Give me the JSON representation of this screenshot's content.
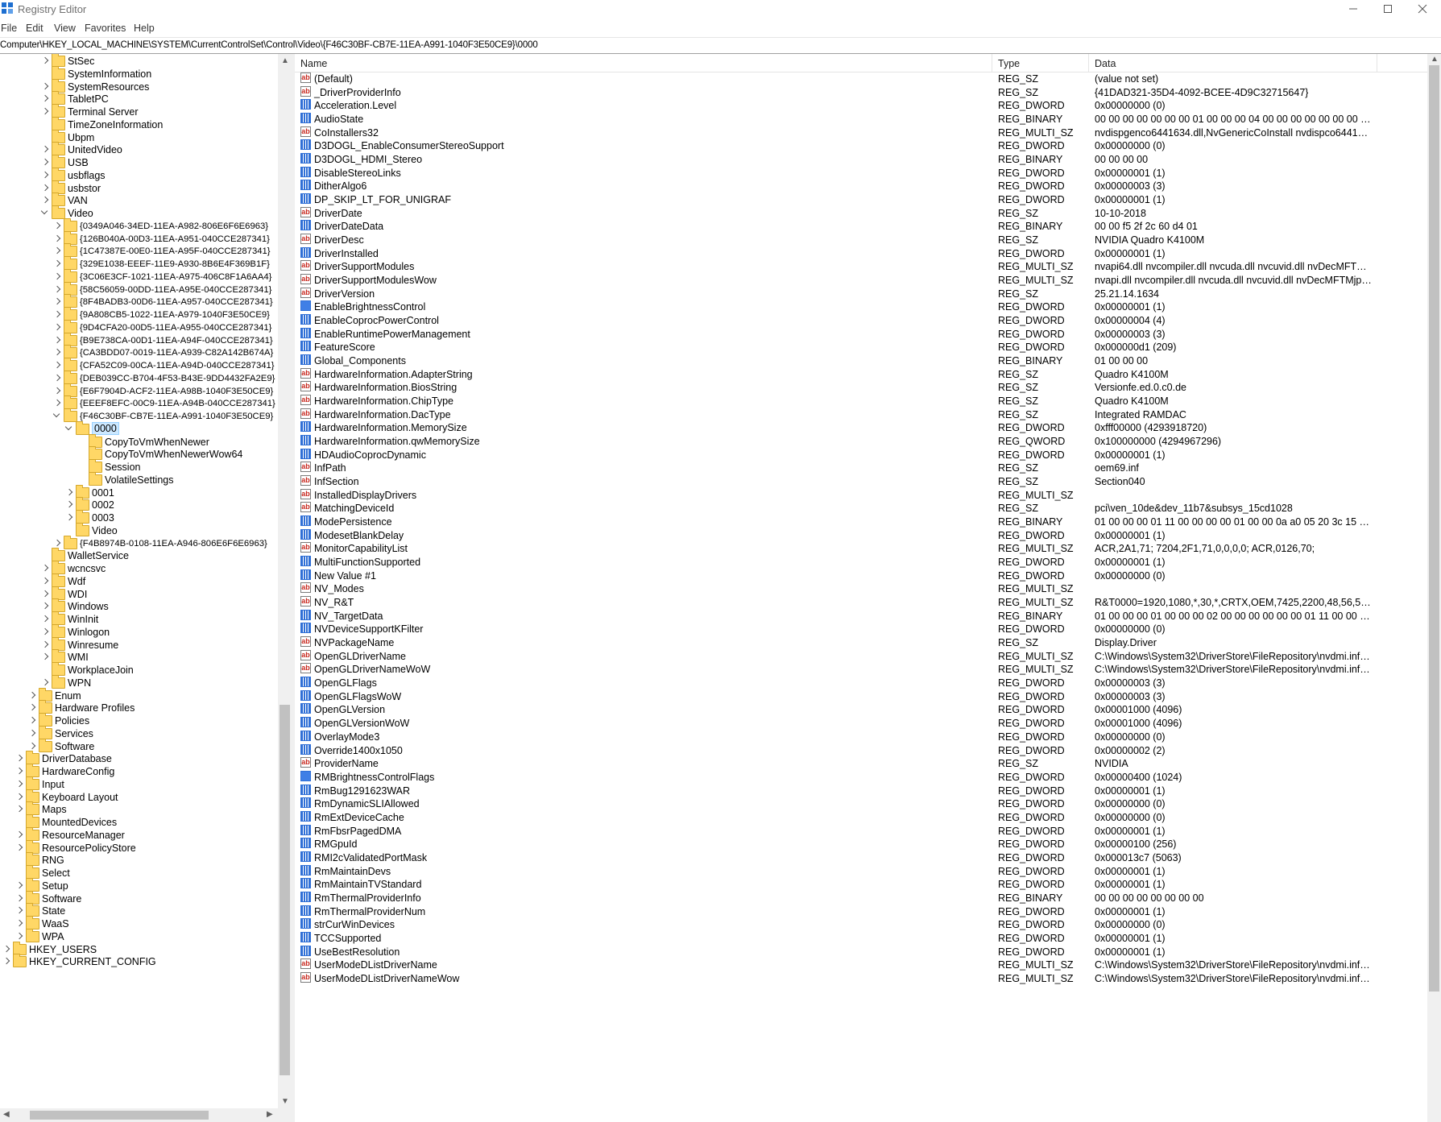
{
  "window": {
    "title": "Registry Editor"
  },
  "menu": [
    "File",
    "Edit",
    "View",
    "Favorites",
    "Help"
  ],
  "address": "Computer\\HKEY_LOCAL_MACHINE\\SYSTEM\\CurrentControlSet\\Control\\Video\\{F46C30BF-CB7E-11EA-A991-1040F3E50CE9}\\0000",
  "tree": [
    {
      "label": "StSec",
      "level": 3,
      "expander": "closed"
    },
    {
      "label": "SystemInformation",
      "level": 3,
      "expander": "none"
    },
    {
      "label": "SystemResources",
      "level": 3,
      "expander": "closed"
    },
    {
      "label": "TabletPC",
      "level": 3,
      "expander": "closed"
    },
    {
      "label": "Terminal Server",
      "level": 3,
      "expander": "closed"
    },
    {
      "label": "TimeZoneInformation",
      "level": 3,
      "expander": "none"
    },
    {
      "label": "Ubpm",
      "level": 3,
      "expander": "none"
    },
    {
      "label": "UnitedVideo",
      "level": 3,
      "expander": "closed"
    },
    {
      "label": "USB",
      "level": 3,
      "expander": "closed"
    },
    {
      "label": "usbflags",
      "level": 3,
      "expander": "closed"
    },
    {
      "label": "usbstor",
      "level": 3,
      "expander": "closed"
    },
    {
      "label": "VAN",
      "level": 3,
      "expander": "closed"
    },
    {
      "label": "Video",
      "level": 3,
      "expander": "open"
    },
    {
      "label": "{0349A046-34ED-11EA-A982-806E6F6E6963}",
      "level": 4,
      "expander": "closed",
      "small": true
    },
    {
      "label": "{126B040A-00D3-11EA-A951-040CCE287341}",
      "level": 4,
      "expander": "closed",
      "small": true
    },
    {
      "label": "{1C47387E-00E0-11EA-A95F-040CCE287341}",
      "level": 4,
      "expander": "closed",
      "small": true
    },
    {
      "label": "{329E1038-EEEF-11E9-A930-8B6E4F369B1F}",
      "level": 4,
      "expander": "closed",
      "small": true
    },
    {
      "label": "{3C06E3CF-1021-11EA-A975-406C8F1A6AA4}",
      "level": 4,
      "expander": "closed",
      "small": true
    },
    {
      "label": "{58C56059-00DD-11EA-A95E-040CCE287341}",
      "level": 4,
      "expander": "closed",
      "small": true
    },
    {
      "label": "{8F4BADB3-00D6-11EA-A957-040CCE287341}",
      "level": 4,
      "expander": "closed",
      "small": true
    },
    {
      "label": "{9A808CB5-1022-11EA-A979-1040F3E50CE9}",
      "level": 4,
      "expander": "closed",
      "small": true
    },
    {
      "label": "{9D4CFA20-00D5-11EA-A955-040CCE287341}",
      "level": 4,
      "expander": "closed",
      "small": true
    },
    {
      "label": "{B9E738CA-00D1-11EA-A94F-040CCE287341}",
      "level": 4,
      "expander": "closed",
      "small": true
    },
    {
      "label": "{CA3BDD07-0019-11EA-A939-C82A142B674A}",
      "level": 4,
      "expander": "closed",
      "small": true
    },
    {
      "label": "{CFA52C09-00CA-11EA-A94D-040CCE287341}",
      "level": 4,
      "expander": "closed",
      "small": true
    },
    {
      "label": "{DEB039CC-B704-4F53-B43E-9DD4432FA2E9}",
      "level": 4,
      "expander": "closed",
      "small": true
    },
    {
      "label": "{E6F7904D-ACF2-11EA-A98B-1040F3E50CE9}",
      "level": 4,
      "expander": "closed",
      "small": true
    },
    {
      "label": "{EEEF8EFC-00C9-11EA-A94B-040CCE287341}",
      "level": 4,
      "expander": "closed",
      "small": true
    },
    {
      "label": "{F46C30BF-CB7E-11EA-A991-1040F3E50CE9}",
      "level": 4,
      "expander": "open",
      "small": true
    },
    {
      "label": "0000",
      "level": 5,
      "expander": "open",
      "selected": true
    },
    {
      "label": "CopyToVmWhenNewer",
      "level": 6,
      "expander": "none"
    },
    {
      "label": "CopyToVmWhenNewerWow64",
      "level": 6,
      "expander": "none"
    },
    {
      "label": "Session",
      "level": 6,
      "expander": "none"
    },
    {
      "label": "VolatileSettings",
      "level": 6,
      "expander": "none"
    },
    {
      "label": "0001",
      "level": 5,
      "expander": "closed"
    },
    {
      "label": "0002",
      "level": 5,
      "expander": "closed"
    },
    {
      "label": "0003",
      "level": 5,
      "expander": "closed"
    },
    {
      "label": "Video",
      "level": 5,
      "expander": "none"
    },
    {
      "label": "{F4B8974B-0108-11EA-A946-806E6F6E6963}",
      "level": 4,
      "expander": "closed",
      "small": true
    },
    {
      "label": "WalletService",
      "level": 3,
      "expander": "none"
    },
    {
      "label": "wcncsvc",
      "level": 3,
      "expander": "closed"
    },
    {
      "label": "Wdf",
      "level": 3,
      "expander": "closed"
    },
    {
      "label": "WDI",
      "level": 3,
      "expander": "closed"
    },
    {
      "label": "Windows",
      "level": 3,
      "expander": "closed"
    },
    {
      "label": "WinInit",
      "level": 3,
      "expander": "closed"
    },
    {
      "label": "Winlogon",
      "level": 3,
      "expander": "closed"
    },
    {
      "label": "Winresume",
      "level": 3,
      "expander": "closed"
    },
    {
      "label": "WMI",
      "level": 3,
      "expander": "closed"
    },
    {
      "label": "WorkplaceJoin",
      "level": 3,
      "expander": "none"
    },
    {
      "label": "WPN",
      "level": 3,
      "expander": "closed"
    },
    {
      "label": "Enum",
      "level": 2,
      "expander": "closed"
    },
    {
      "label": "Hardware Profiles",
      "level": 2,
      "expander": "closed"
    },
    {
      "label": "Policies",
      "level": 2,
      "expander": "closed"
    },
    {
      "label": "Services",
      "level": 2,
      "expander": "closed"
    },
    {
      "label": "Software",
      "level": 2,
      "expander": "closed"
    },
    {
      "label": "DriverDatabase",
      "level": 1,
      "expander": "closed"
    },
    {
      "label": "HardwareConfig",
      "level": 1,
      "expander": "closed"
    },
    {
      "label": "Input",
      "level": 1,
      "expander": "closed"
    },
    {
      "label": "Keyboard Layout",
      "level": 1,
      "expander": "closed"
    },
    {
      "label": "Maps",
      "level": 1,
      "expander": "closed"
    },
    {
      "label": "MountedDevices",
      "level": 1,
      "expander": "none"
    },
    {
      "label": "ResourceManager",
      "level": 1,
      "expander": "closed"
    },
    {
      "label": "ResourcePolicyStore",
      "level": 1,
      "expander": "closed"
    },
    {
      "label": "RNG",
      "level": 1,
      "expander": "none"
    },
    {
      "label": "Select",
      "level": 1,
      "expander": "none"
    },
    {
      "label": "Setup",
      "level": 1,
      "expander": "closed"
    },
    {
      "label": "Software",
      "level": 1,
      "expander": "closed"
    },
    {
      "label": "State",
      "level": 1,
      "expander": "closed"
    },
    {
      "label": "WaaS",
      "level": 1,
      "expander": "closed"
    },
    {
      "label": "WPA",
      "level": 1,
      "expander": "closed"
    },
    {
      "label": "HKEY_USERS",
      "level": 0,
      "expander": "closed"
    },
    {
      "label": "HKEY_CURRENT_CONFIG",
      "level": 0,
      "expander": "closed"
    }
  ],
  "columns": {
    "name": "Name",
    "type": "Type",
    "data": "Data"
  },
  "values": [
    {
      "name": "(Default)",
      "type": "REG_SZ",
      "data": "(value not set)",
      "icon": "sz"
    },
    {
      "name": "_DriverProviderInfo",
      "type": "REG_SZ",
      "data": "{41DAD321-35D4-4092-BCEE-4D9C32715647}",
      "icon": "sz"
    },
    {
      "name": "Acceleration.Level",
      "type": "REG_DWORD",
      "data": "0x00000000 (0)",
      "icon": "bin"
    },
    {
      "name": "AudioState",
      "type": "REG_BINARY",
      "data": "00 00 00 00 00 00 00 01 00 00 00 04 00 00 00 00 00 00 00 00 00 0...",
      "icon": "bin"
    },
    {
      "name": "CoInstallers32",
      "type": "REG_MULTI_SZ",
      "data": "nvdispgenco6441634.dll,NvGenericCoInstall nvdispco6441634.dll...",
      "icon": "sz"
    },
    {
      "name": "D3DOGL_EnableConsumerStereoSupport",
      "type": "REG_DWORD",
      "data": "0x00000000 (0)",
      "icon": "bin"
    },
    {
      "name": "D3DOGL_HDMI_Stereo",
      "type": "REG_BINARY",
      "data": "00 00 00 00",
      "icon": "bin"
    },
    {
      "name": "DisableStereoLinks",
      "type": "REG_DWORD",
      "data": "0x00000001 (1)",
      "icon": "bin"
    },
    {
      "name": "DitherAlgo6",
      "type": "REG_DWORD",
      "data": "0x00000003 (3)",
      "icon": "bin"
    },
    {
      "name": "DP_SKIP_LT_FOR_UNIGRAF",
      "type": "REG_DWORD",
      "data": "0x00000001 (1)",
      "icon": "bin"
    },
    {
      "name": "DriverDate",
      "type": "REG_SZ",
      "data": "10-10-2018",
      "icon": "sz"
    },
    {
      "name": "DriverDateData",
      "type": "REG_BINARY",
      "data": "00 00 f5 2f 2c 60 d4 01",
      "icon": "bin"
    },
    {
      "name": "DriverDesc",
      "type": "REG_SZ",
      "data": "NVIDIA Quadro K4100M",
      "icon": "sz"
    },
    {
      "name": "DriverInstalled",
      "type": "REG_DWORD",
      "data": "0x00000001 (1)",
      "icon": "bin"
    },
    {
      "name": "DriverSupportModules",
      "type": "REG_MULTI_SZ",
      "data": "nvapi64.dll nvcompiler.dll nvcuda.dll nvcuvid.dll nvDecMFTMjp...",
      "icon": "sz"
    },
    {
      "name": "DriverSupportModulesWow",
      "type": "REG_MULTI_SZ",
      "data": "nvapi.dll nvcompiler.dll nvcuda.dll nvcuvid.dll nvDecMFTMjpeg...",
      "icon": "sz"
    },
    {
      "name": "DriverVersion",
      "type": "REG_SZ",
      "data": "25.21.14.1634",
      "icon": "sz"
    },
    {
      "name": "EnableBrightnessControl",
      "type": "REG_DWORD",
      "data": "0x00000001 (1)",
      "icon": "binsel"
    },
    {
      "name": "EnableCoprocPowerControl",
      "type": "REG_DWORD",
      "data": "0x00000004 (4)",
      "icon": "bin"
    },
    {
      "name": "EnableRuntimePowerManagement",
      "type": "REG_DWORD",
      "data": "0x00000003 (3)",
      "icon": "bin"
    },
    {
      "name": "FeatureScore",
      "type": "REG_DWORD",
      "data": "0x000000d1 (209)",
      "icon": "bin"
    },
    {
      "name": "Global_Components",
      "type": "REG_BINARY",
      "data": "01 00 00 00",
      "icon": "bin"
    },
    {
      "name": "HardwareInformation.AdapterString",
      "type": "REG_SZ",
      "data": "Quadro K4100M",
      "icon": "sz"
    },
    {
      "name": "HardwareInformation.BiosString",
      "type": "REG_SZ",
      "data": "Versionfe.ed.0.c0.de",
      "icon": "sz"
    },
    {
      "name": "HardwareInformation.ChipType",
      "type": "REG_SZ",
      "data": "Quadro K4100M",
      "icon": "sz"
    },
    {
      "name": "HardwareInformation.DacType",
      "type": "REG_SZ",
      "data": "Integrated RAMDAC",
      "icon": "sz"
    },
    {
      "name": "HardwareInformation.MemorySize",
      "type": "REG_DWORD",
      "data": "0xfff00000 (4293918720)",
      "icon": "bin"
    },
    {
      "name": "HardwareInformation.qwMemorySize",
      "type": "REG_QWORD",
      "data": "0x100000000 (4294967296)",
      "icon": "bin"
    },
    {
      "name": "HDAudioCoprocDynamic",
      "type": "REG_DWORD",
      "data": "0x00000001 (1)",
      "icon": "bin"
    },
    {
      "name": "InfPath",
      "type": "REG_SZ",
      "data": "oem69.inf",
      "icon": "sz"
    },
    {
      "name": "InfSection",
      "type": "REG_SZ",
      "data": "Section040",
      "icon": "sz"
    },
    {
      "name": "InstalledDisplayDrivers",
      "type": "REG_MULTI_SZ",
      "data": "",
      "icon": "sz"
    },
    {
      "name": "MatchingDeviceId",
      "type": "REG_SZ",
      "data": "pci\\ven_10de&dev_11b7&subsys_15cd1028",
      "icon": "sz"
    },
    {
      "name": "ModePersistence",
      "type": "REG_BINARY",
      "data": "01 00 00 00 01 11 00 00 00 00 01 00 00 0a a0 05 20 3c 15 00 00 00 0...",
      "icon": "bin"
    },
    {
      "name": "ModesetBlankDelay",
      "type": "REG_DWORD",
      "data": "0x00000001 (1)",
      "icon": "bin"
    },
    {
      "name": "MonitorCapabilityList",
      "type": "REG_MULTI_SZ",
      "data": "ACR,2A1,71; 7204,2F1,71,0,0,0,0; ACR,0126,70;",
      "icon": "sz"
    },
    {
      "name": "MultiFunctionSupported",
      "type": "REG_DWORD",
      "data": "0x00000001 (1)",
      "icon": "bin"
    },
    {
      "name": "New Value #1",
      "type": "REG_DWORD",
      "data": "0x00000000 (0)",
      "icon": "bin"
    },
    {
      "name": "NV_Modes",
      "type": "REG_MULTI_SZ",
      "data": "",
      "icon": "sz"
    },
    {
      "name": "NV_R&T",
      "type": "REG_MULTI_SZ",
      "data": "R&T0000=1920,1080,*,30,*,CRTX,OEM,7425,2200,48,56,562,2,5,+...",
      "icon": "sz"
    },
    {
      "name": "NV_TargetData",
      "type": "REG_BINARY",
      "data": "01 00 00 00 01 00 00 00 02 00 00 00 00 00 00 01 11 00 00 01 00 0...",
      "icon": "bin"
    },
    {
      "name": "NVDeviceSupportKFilter",
      "type": "REG_DWORD",
      "data": "0x00000000 (0)",
      "icon": "bin"
    },
    {
      "name": "NVPackageName",
      "type": "REG_SZ",
      "data": "Display.Driver",
      "icon": "sz"
    },
    {
      "name": "OpenGLDriverName",
      "type": "REG_MULTI_SZ",
      "data": "C:\\Windows\\System32\\DriverStore\\FileRepository\\nvdmi.inf_a...",
      "icon": "sz"
    },
    {
      "name": "OpenGLDriverNameWoW",
      "type": "REG_MULTI_SZ",
      "data": "C:\\Windows\\System32\\DriverStore\\FileRepository\\nvdmi.inf_a...",
      "icon": "sz"
    },
    {
      "name": "OpenGLFlags",
      "type": "REG_DWORD",
      "data": "0x00000003 (3)",
      "icon": "bin"
    },
    {
      "name": "OpenGLFlagsWoW",
      "type": "REG_DWORD",
      "data": "0x00000003 (3)",
      "icon": "bin"
    },
    {
      "name": "OpenGLVersion",
      "type": "REG_DWORD",
      "data": "0x00001000 (4096)",
      "icon": "bin"
    },
    {
      "name": "OpenGLVersionWoW",
      "type": "REG_DWORD",
      "data": "0x00001000 (4096)",
      "icon": "bin"
    },
    {
      "name": "OverlayMode3",
      "type": "REG_DWORD",
      "data": "0x00000000 (0)",
      "icon": "bin"
    },
    {
      "name": "Override1400x1050",
      "type": "REG_DWORD",
      "data": "0x00000002 (2)",
      "icon": "bin"
    },
    {
      "name": "ProviderName",
      "type": "REG_SZ",
      "data": "NVIDIA",
      "icon": "sz"
    },
    {
      "name": "RMBrightnessControlFlags",
      "type": "REG_DWORD",
      "data": "0x00000400 (1024)",
      "icon": "binsel"
    },
    {
      "name": "RmBug1291623WAR",
      "type": "REG_DWORD",
      "data": "0x00000001 (1)",
      "icon": "bin"
    },
    {
      "name": "RmDynamicSLIAllowed",
      "type": "REG_DWORD",
      "data": "0x00000000 (0)",
      "icon": "bin"
    },
    {
      "name": "RmExtDeviceCache",
      "type": "REG_DWORD",
      "data": "0x00000000 (0)",
      "icon": "bin"
    },
    {
      "name": "RmFbsrPagedDMA",
      "type": "REG_DWORD",
      "data": "0x00000001 (1)",
      "icon": "bin"
    },
    {
      "name": "RMGpuId",
      "type": "REG_DWORD",
      "data": "0x00000100 (256)",
      "icon": "bin"
    },
    {
      "name": "RMI2cValidatedPortMask",
      "type": "REG_DWORD",
      "data": "0x000013c7 (5063)",
      "icon": "bin"
    },
    {
      "name": "RmMaintainDevs",
      "type": "REG_DWORD",
      "data": "0x00000001 (1)",
      "icon": "bin"
    },
    {
      "name": "RmMaintainTVStandard",
      "type": "REG_DWORD",
      "data": "0x00000001 (1)",
      "icon": "bin"
    },
    {
      "name": "RmThermalProviderInfo",
      "type": "REG_BINARY",
      "data": "00 00 00 00 00 00 00 00",
      "icon": "bin"
    },
    {
      "name": "RmThermalProviderNum",
      "type": "REG_DWORD",
      "data": "0x00000001 (1)",
      "icon": "bin"
    },
    {
      "name": "strCurWinDevices",
      "type": "REG_DWORD",
      "data": "0x00000000 (0)",
      "icon": "bin"
    },
    {
      "name": "TCCSupported",
      "type": "REG_DWORD",
      "data": "0x00000001 (1)",
      "icon": "bin"
    },
    {
      "name": "UseBestResolution",
      "type": "REG_DWORD",
      "data": "0x00000001 (1)",
      "icon": "bin"
    },
    {
      "name": "UserModeDListDriverName",
      "type": "REG_MULTI_SZ",
      "data": "C:\\Windows\\System32\\DriverStore\\FileRepository\\nvdmi.inf_a...",
      "icon": "sz"
    },
    {
      "name": "UserModeDListDriverNameWow",
      "type": "REG_MULTI_SZ",
      "data": "C:\\Windows\\System32\\DriverStore\\FileRepository\\nvdmi.inf_a...",
      "icon": "sz"
    }
  ]
}
